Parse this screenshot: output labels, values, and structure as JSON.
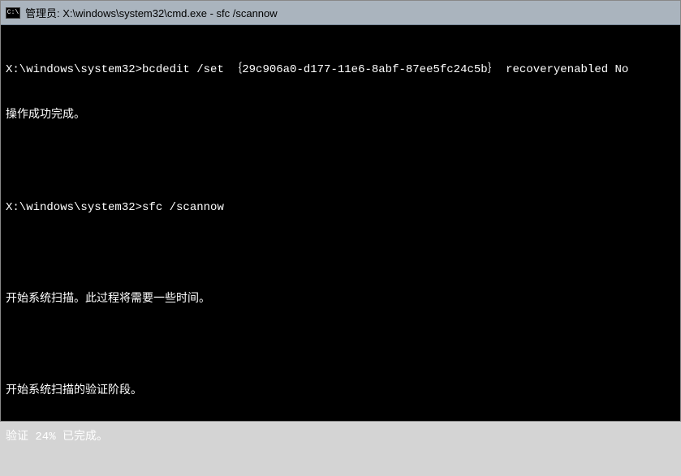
{
  "titlebar": {
    "icon_label": "C:\\",
    "title": "管理员: X:\\windows\\system32\\cmd.exe - sfc  /scannow"
  },
  "terminal": {
    "lines": [
      "X:\\windows\\system32>bcdedit /set ｛29c906a0-d177-11e6-8abf-87ee5fc24c5b｝ recoveryenabled No",
      "操作成功完成。",
      "",
      "X:\\windows\\system32>sfc /scannow",
      "",
      "开始系统扫描。此过程将需要一些时间。",
      "",
      "开始系统扫描的验证阶段。",
      "验证 24% 已完成。"
    ]
  }
}
